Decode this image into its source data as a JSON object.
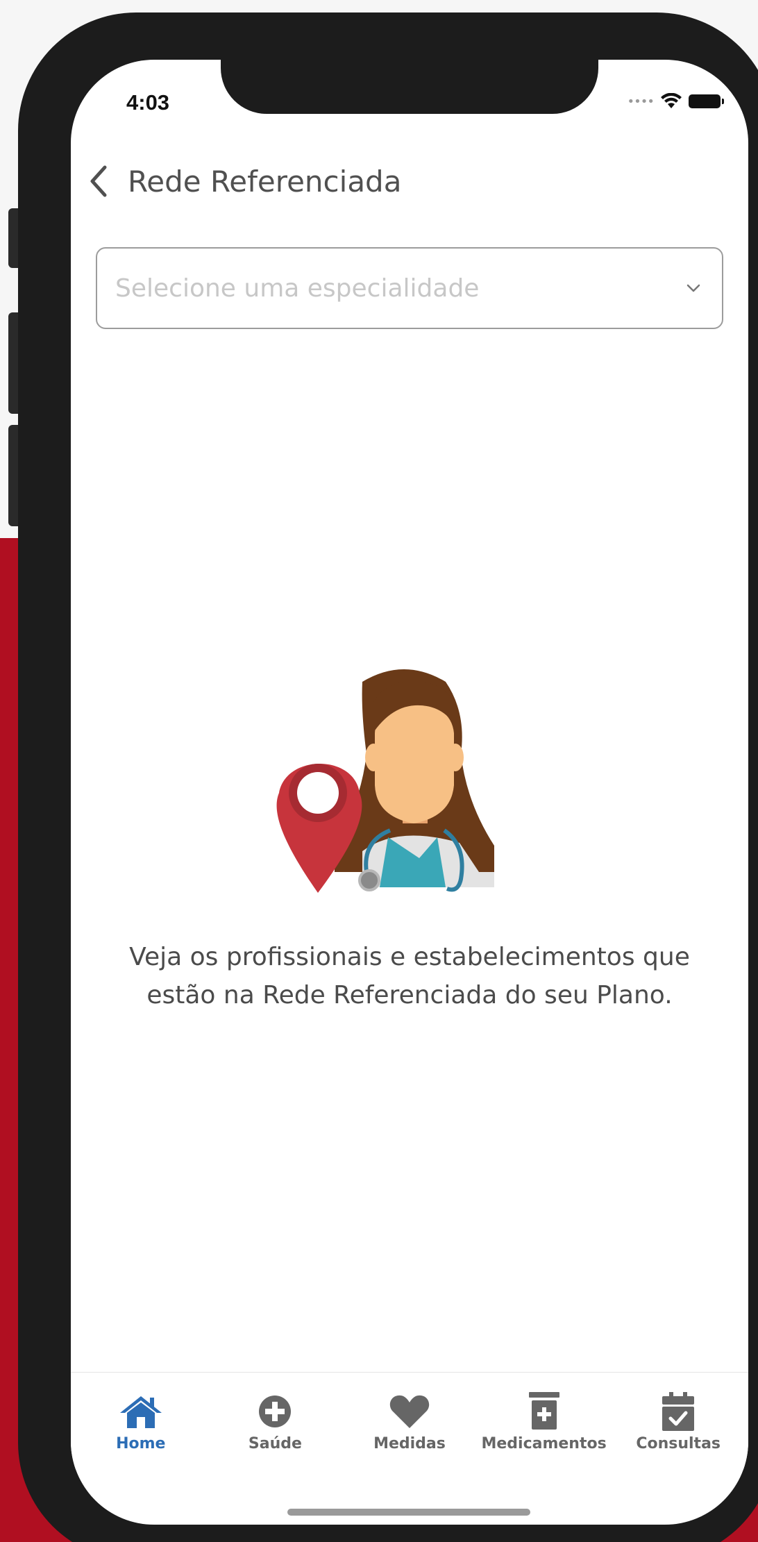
{
  "status_bar": {
    "time": "4:03"
  },
  "header": {
    "title": "Rede Referenciada"
  },
  "specialty_select": {
    "placeholder": "Selecione uma especialidade"
  },
  "empty_state": {
    "line1": "Veja os profissionais e estabelecimentos que",
    "line2": "estão na Rede Referenciada do seu Plano."
  },
  "tab_bar": {
    "items": [
      {
        "label": "Home",
        "icon": "home-icon",
        "active": true
      },
      {
        "label": "Saúde",
        "icon": "plus-circle-icon",
        "active": false
      },
      {
        "label": "Medidas",
        "icon": "heart-icon",
        "active": false
      },
      {
        "label": "Medicamentos",
        "icon": "medicine-bottle-icon",
        "active": false
      },
      {
        "label": "Consultas",
        "icon": "calendar-check-icon",
        "active": false
      }
    ]
  },
  "colors": {
    "accent_blue": "#2c6db5",
    "background_red": "#b00f21",
    "pin_red": "#c7343c",
    "tab_gray": "#666666"
  }
}
